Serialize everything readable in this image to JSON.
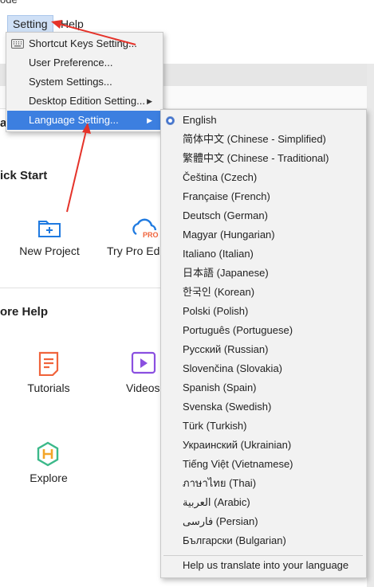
{
  "window": {
    "title_fragment": "ode"
  },
  "menubar": {
    "setting": "Setting",
    "help": "Help"
  },
  "setting_menu": {
    "items": [
      {
        "label": "Shortcut Keys Setting...",
        "icon": "keyboard-icon",
        "submenu": false
      },
      {
        "label": "User Preference...",
        "submenu": false
      },
      {
        "label": "System Settings...",
        "submenu": false
      },
      {
        "label": "Desktop Edition Setting...",
        "submenu": true
      },
      {
        "label": "Language Setting...",
        "submenu": true,
        "highlighted": true
      }
    ]
  },
  "language_menu": {
    "languages": [
      "English",
      "简体中文 (Chinese - Simplified)",
      "繁體中文 (Chinese - Traditional)",
      "Čeština (Czech)",
      "Française (French)",
      "Deutsch (German)",
      "Magyar (Hungarian)",
      "Italiano (Italian)",
      "日本語 (Japanese)",
      "한국인 (Korean)",
      "Polski (Polish)",
      "Português (Portuguese)",
      "Русский (Russian)",
      "Slovenčina (Slovakia)",
      "Spanish (Spain)",
      "Svenska (Swedish)",
      "Türk (Turkish)",
      "Украинский (Ukrainian)",
      "Tiếng Việt (Vietnamese)",
      "ภาษาไทย (Thai)",
      "العربية (Arabic)",
      "فارسی (Persian)",
      "Български (Bulgarian)"
    ],
    "selected": "English",
    "help_translate": "Help us translate into your language"
  },
  "main": {
    "partial_heading_char": "a",
    "quick_start": {
      "heading": "ick Start",
      "tiles": [
        {
          "label": "New Project",
          "icon": "new-project-folder-icon"
        },
        {
          "label": "Try Pro Ed",
          "icon": "cloud-pro-icon",
          "badge": "PRO"
        }
      ]
    },
    "more_help": {
      "heading": "ore Help",
      "tiles": [
        {
          "label": "Tutorials",
          "icon": "tutorials-document-icon"
        },
        {
          "label": "Videos",
          "icon": "video-play-icon"
        },
        {
          "label": "Explore",
          "icon": "explore-hexagon-icon"
        }
      ]
    }
  },
  "colors": {
    "menu_highlight": "#3c7fe0",
    "annotation_arrow": "#e5332a",
    "icon_blue": "#1f7ae0",
    "icon_orange": "#f0643c",
    "icon_purple": "#8a4fe0"
  }
}
